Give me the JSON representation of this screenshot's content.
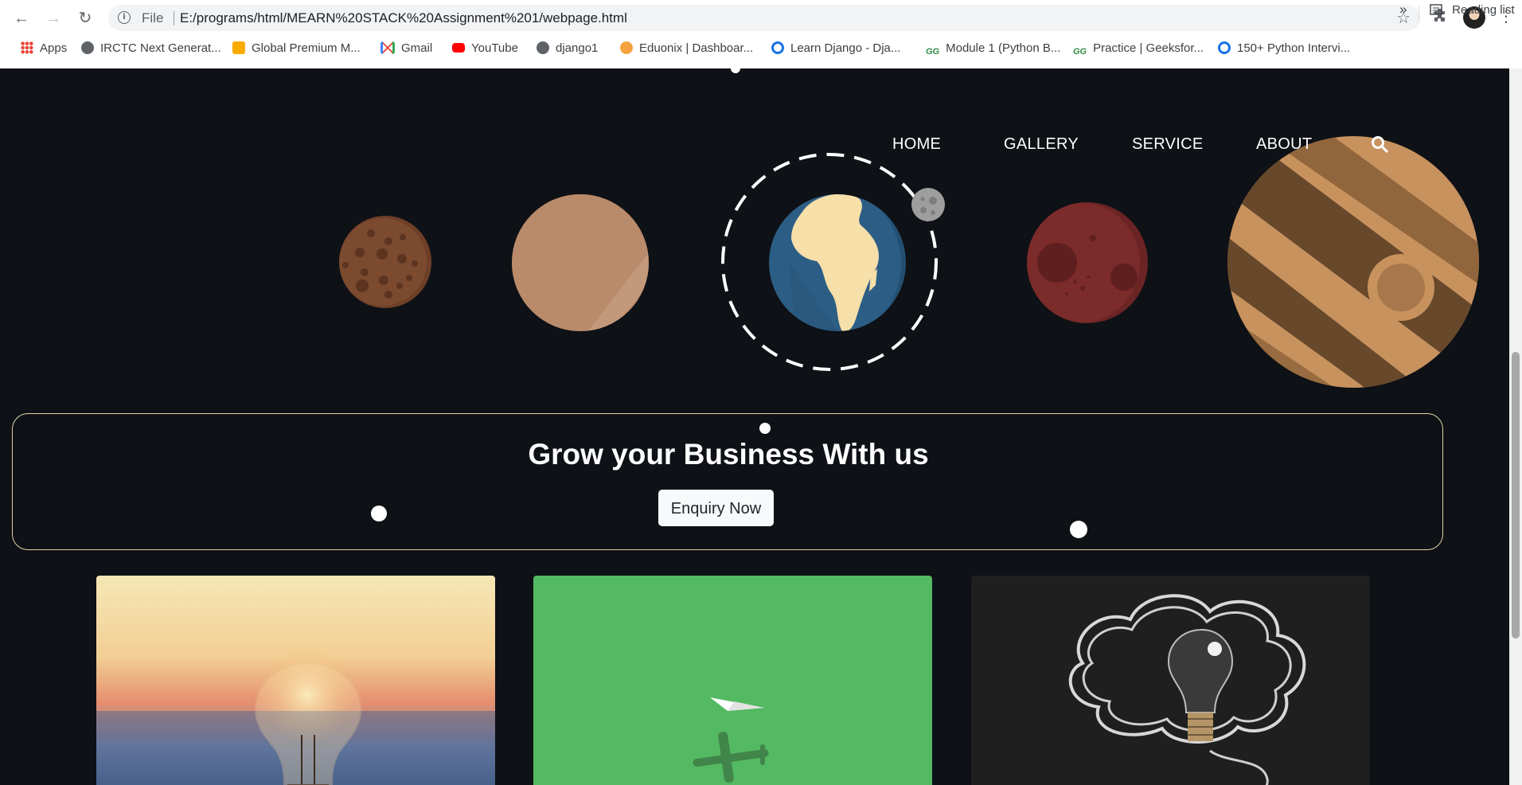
{
  "browser": {
    "omnibox": {
      "scheme_label": "File",
      "url": "E:/programs/html/MEARN%20STACK%20Assignment%201/webpage.html"
    },
    "bookmarks": [
      {
        "label": "Apps",
        "icon": "apps-grid-icon",
        "color": "#ea4335"
      },
      {
        "label": "IRCTC Next Generat...",
        "icon": "globe-icon",
        "color": "#5f6368"
      },
      {
        "label": "Global Premium M...",
        "icon": "global-premium-icon",
        "color": "#f9ab00"
      },
      {
        "label": "Gmail",
        "icon": "gmail-icon",
        "color": "#ea4335"
      },
      {
        "label": "YouTube",
        "icon": "youtube-icon",
        "color": "#ff0000"
      },
      {
        "label": "django1",
        "icon": "globe-icon",
        "color": "#5f6368"
      },
      {
        "label": "Eduonix | Dashboar...",
        "icon": "eduonix-icon",
        "color": "#f4a340"
      },
      {
        "label": "Learn Django - Dja...",
        "icon": "django-icon",
        "color": "#1a73e8"
      },
      {
        "label": "Module 1 (Python B...",
        "icon": "geeksforgeeks-icon",
        "color": "#2f8d46"
      },
      {
        "label": "Practice | Geeksfor...",
        "icon": "geeksforgeeks-icon",
        "color": "#2f8d46"
      },
      {
        "label": "150+ Python Intervi...",
        "icon": "python-icon",
        "color": "#1a73e8"
      }
    ],
    "bookmarks_more": "»",
    "reading_list": "Reading list"
  },
  "nav": {
    "items": [
      "HOME",
      "GALLERY",
      "SERVICE",
      "ABOUT"
    ]
  },
  "banner": {
    "title": "Grow your Business With us",
    "button": "Enquiry Now"
  },
  "cards": [
    {
      "image": "lightbulb-sunset-photo"
    },
    {
      "image": "paper-plane-green-photo"
    },
    {
      "image": "lightbulb-chalkboard-photo"
    }
  ],
  "colors": {
    "page_background": "#0e1116",
    "banner_border": "#e0d3a8",
    "earth_ocean": "#2c5e85",
    "earth_land": "#f7dfa9",
    "mars": "#7a2b2a",
    "jupiter_light": "#c8925e",
    "jupiter_dark": "#5c4026",
    "mercury": "#7b4a2f",
    "venus": "#b98b6b"
  }
}
